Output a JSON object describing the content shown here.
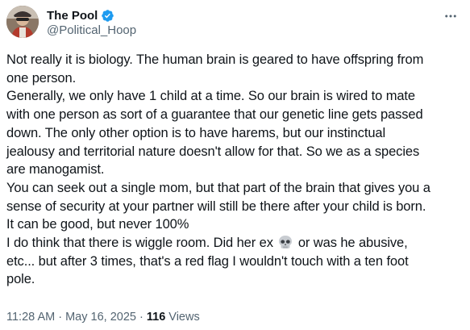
{
  "author": {
    "display_name": "The Pool",
    "handle": "@Political_Hoop",
    "verified": true,
    "avatar_icon": "avatar-photo",
    "verified_color": "#1d9bf0"
  },
  "more_icon": "more-horizontal-icon",
  "body": {
    "lines": [
      "Not really it is biology. The human brain is geared to have offspring from",
      "one person.",
      "Generally, we only have 1 child at a time. So our brain is wired to mate",
      "with one person as sort of a guarantee that our genetic line gets passed",
      "down. The only other option is to have harems, but our instinctual",
      "jealousy and territorial nature doesn't allow for that. So we as a species",
      "are manogamist.",
      "You can seek out a single mom, but that part of the brain that gives you a",
      "sense of security at your partner will still be there after your child is born.",
      "It can be good, but never 100%"
    ],
    "skull_line_before": "I do think that there is wiggle room. Did her ex",
    "skull_emoji": "💀",
    "skull_line_after": " or was he abusive,",
    "final_lines": [
      "etc... but after 3 times, that's a red flag I wouldn't touch with a ten foot",
      "pole."
    ]
  },
  "meta": {
    "time": "11:28 AM",
    "separator1": " · ",
    "date": "May 16, 2025",
    "separator2": " · ",
    "views_count": "116",
    "views_label": " Views"
  }
}
